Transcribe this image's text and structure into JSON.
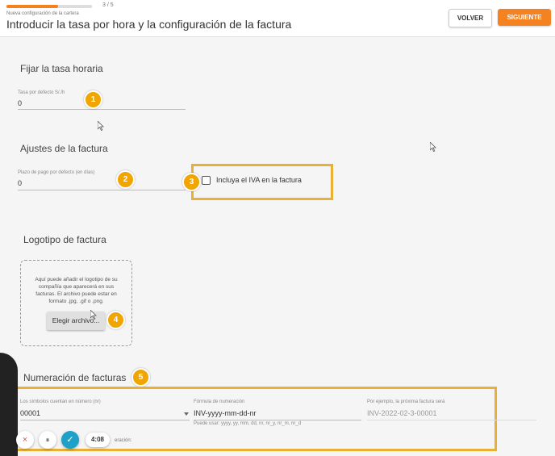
{
  "header": {
    "progress_text": "3 / 5",
    "progress_fraction": 0.6,
    "subtitle": "Nueva configuración de la cartera",
    "title": "Introducir la tasa por hora y la configuración de la factura",
    "back_label": "VOLVER",
    "next_label": "SIGUIENTE"
  },
  "rate": {
    "section_title": "Fijar la tasa horaria",
    "label": "Tasa por defecto S/./h",
    "value": "0",
    "badge": "1"
  },
  "invoice": {
    "section_title": "Ajustes de la factura",
    "payment_label": "Plazo de pago por defecto (en días)",
    "payment_value": "0",
    "payment_badge": "2",
    "vat_badge": "3",
    "vat_label": "Incluya el IVA en la factura",
    "vat_checked": false
  },
  "logo": {
    "section_title": "Logotipo de factura",
    "description": "Aquí puede añadir el logotipo de su compañía que aparecerá en sus facturas. El archivo puede estar en formato .jpg, .gif o .png.",
    "button_label": "Elegir archivo...",
    "badge": "4"
  },
  "numbering": {
    "section_title": "Numeración de facturas",
    "badge": "5",
    "digits_label": "Los símbolos cuentan en número (nr)",
    "digits_value": "00001",
    "formula_label": "Fórmula de numeración",
    "formula_value": "INV-yyyy-mm-dd-nr",
    "formula_hint": "Puede usar: yyyy, yy, mm, dd, nr, nr_y, nr_m, nr_d",
    "example_label": "Por ejemplo, la próxima factura será",
    "example_value": "INV-2022-02-3-00001",
    "bottom_cut_text": "eración:"
  },
  "recorder": {
    "close_icon": "×",
    "pause_icon": "⏸",
    "check_icon": "✓",
    "time": "4:08"
  },
  "colors": {
    "accent": "#f58220",
    "highlight": "#e9b036",
    "badge": "#f0a500",
    "recorder_check": "#1ea1c8"
  }
}
